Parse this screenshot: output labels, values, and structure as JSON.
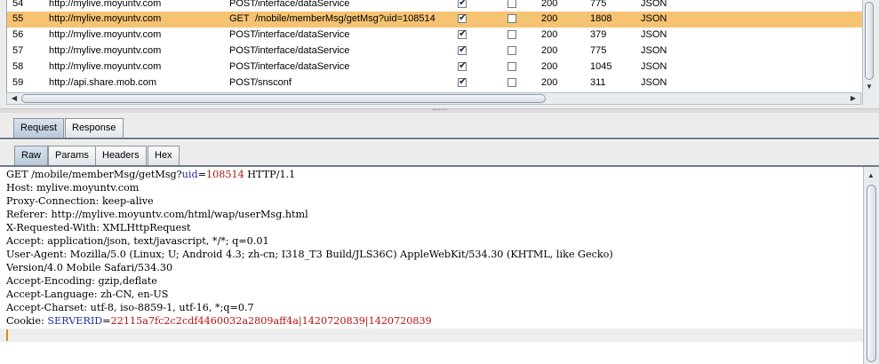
{
  "history": {
    "rows": [
      {
        "num": "54",
        "host": "http://mylive.moyuntv.com",
        "method": "POST",
        "url": "/interface/dataService",
        "edited": true,
        "cookies": false,
        "status": "200",
        "length": "775",
        "mime": "JSON",
        "selected": false
      },
      {
        "num": "55",
        "host": "http://mylive.moyuntv.com",
        "method": "GET",
        "url": "/mobile/memberMsg/getMsg?uid=108514",
        "edited": true,
        "cookies": false,
        "status": "200",
        "length": "1808",
        "mime": "JSON",
        "selected": true
      },
      {
        "num": "56",
        "host": "http://mylive.moyuntv.com",
        "method": "POST",
        "url": "/interface/dataService",
        "edited": true,
        "cookies": false,
        "status": "200",
        "length": "379",
        "mime": "JSON",
        "selected": false
      },
      {
        "num": "57",
        "host": "http://mylive.moyuntv.com",
        "method": "POST",
        "url": "/interface/dataService",
        "edited": true,
        "cookies": false,
        "status": "200",
        "length": "775",
        "mime": "JSON",
        "selected": false
      },
      {
        "num": "58",
        "host": "http://mylive.moyuntv.com",
        "method": "POST",
        "url": "/interface/dataService",
        "edited": true,
        "cookies": false,
        "status": "200",
        "length": "1045",
        "mime": "JSON",
        "selected": false
      },
      {
        "num": "59",
        "host": "http://api.share.mob.com",
        "method": "POST",
        "url": "/snsconf",
        "edited": true,
        "cookies": false,
        "status": "200",
        "length": "311",
        "mime": "JSON",
        "selected": false
      }
    ]
  },
  "main_tabs": [
    {
      "label": "Request",
      "active": true
    },
    {
      "label": "Response",
      "active": false
    }
  ],
  "sub_tabs": [
    {
      "label": "Raw",
      "active": true
    },
    {
      "label": "Params",
      "active": false
    },
    {
      "label": "Headers",
      "active": false
    },
    {
      "label": "Hex",
      "active": false
    }
  ],
  "raw_request": {
    "request_line": {
      "prefix": "GET /mobile/memberMsg/getMsg?",
      "param": "uid",
      "eq": "=",
      "value": "108514",
      "suffix": " HTTP/1.1"
    },
    "headers": [
      "Host: mylive.moyuntv.com",
      "Proxy-Connection: keep-alive",
      "Referer: http://mylive.moyuntv.com/html/wap/userMsg.html",
      "X-Requested-With: XMLHttpRequest",
      "Accept: application/json, text/javascript, */*; q=0.01",
      "User-Agent: Mozilla/5.0 (Linux; U; Android 4.3; zh-cn; I318_T3 Build/JLS36C) AppleWebKit/534.30 (KHTML, like Gecko)",
      "Version/4.0 Mobile Safari/534.30",
      "Accept-Encoding: gzip,deflate",
      "Accept-Language: zh-CN, en-US",
      "Accept-Charset: utf-8, iso-8859-1, utf-16, *;q=0.7"
    ],
    "cookie_line": {
      "prefix": "Cookie: ",
      "param": "SERVERID",
      "eq": "=",
      "value": "22115a7fc2c2cdf4460032a2809aff4a|1420720839|1420720839"
    }
  },
  "icons": {
    "left_arrow": "scroll-left-icon",
    "right_arrow": "scroll-right-icon",
    "up_arrow": "scroll-up-icon",
    "down_arrow": "scroll-down-icon"
  }
}
